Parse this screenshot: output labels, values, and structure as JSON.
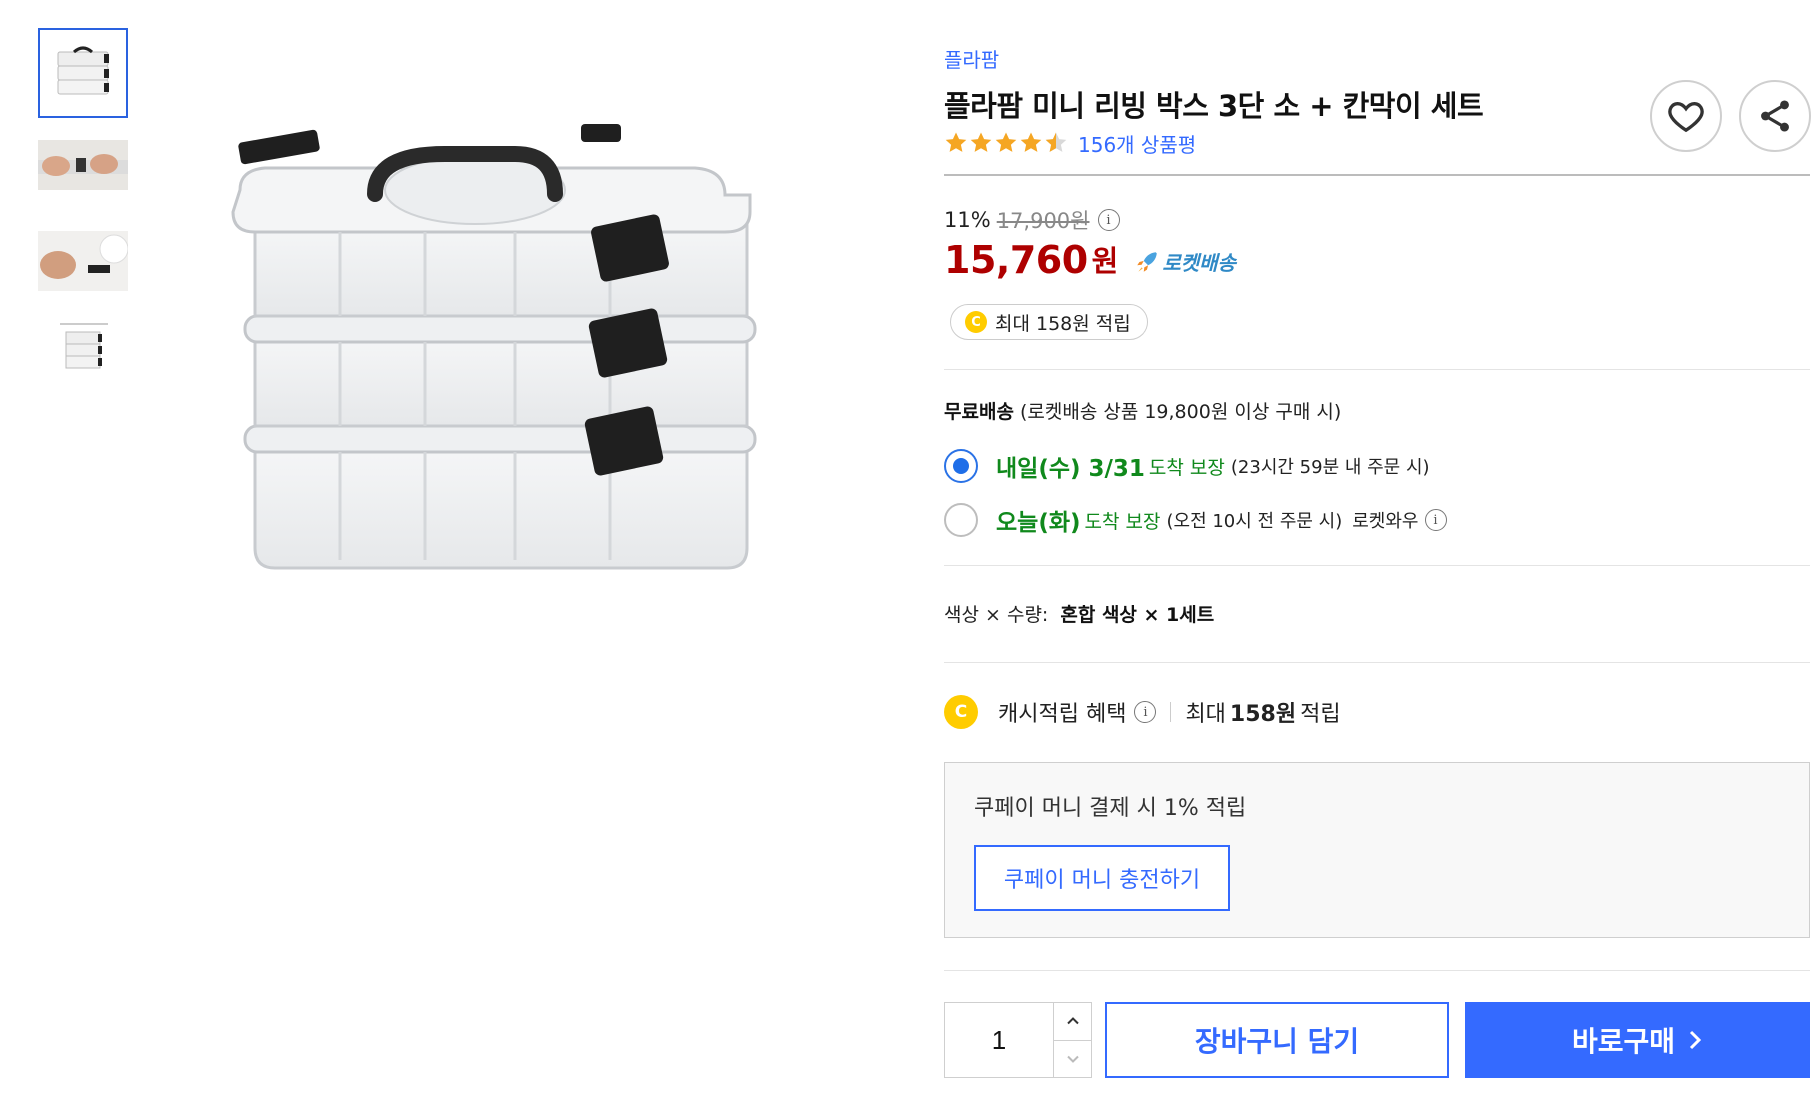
{
  "product": {
    "brand": "플라팜",
    "title": "플라팜 미니 리빙 박스 3단 소 + 칸막이 세트",
    "review_count_label": "156개 상품평",
    "rating": 4.5
  },
  "price": {
    "discount_rate": "11%",
    "original_price": "17,900원",
    "sale_price": "15,760",
    "sale_unit": "원",
    "rocket_label": "로켓배송",
    "cash_back_pill": "최대 158원 적립"
  },
  "coin_letter": "C",
  "info_letter": "i",
  "shipping": {
    "free_label": "무료배송",
    "free_condition": "(로켓배송 상품 19,800원 이상 구매 시)",
    "options": [
      {
        "date": "내일(수) 3/31",
        "guarantee": "도착 보장",
        "note": "(23시간 59분 내 주문 시)",
        "extra": "",
        "selected": true
      },
      {
        "date": "오늘(화)",
        "guarantee": "도착 보장",
        "note": "(오전 10시 전 주문 시)",
        "extra": "로켓와우",
        "selected": false
      }
    ]
  },
  "variant": {
    "label": "색상 × 수량:",
    "value": "혼합 색상 × 1세트"
  },
  "benefit": {
    "label": "캐시적립 혜택",
    "max_prefix": "최대",
    "max_amount": "158원",
    "max_suffix": "적립"
  },
  "kpay": {
    "text": "쿠페이 머니 결제 시 1% 적립",
    "button": "쿠페이 머니 충전하기"
  },
  "purchase": {
    "quantity": "1",
    "cart_button": "장바구니 담기",
    "buy_button": "바로구매"
  },
  "colors": {
    "accent_blue": "#346aff",
    "price_red": "#ae0000",
    "delivery_green": "#10891c",
    "rocket_blue": "#2f89c6",
    "star": "#f5a623",
    "coin": "#ffcc00"
  },
  "icons": [
    "heart-icon",
    "share-icon",
    "star-icon",
    "rocket-icon",
    "info-icon",
    "coin-icon",
    "chevron-up-icon",
    "chevron-down-icon",
    "chevron-right-icon"
  ]
}
